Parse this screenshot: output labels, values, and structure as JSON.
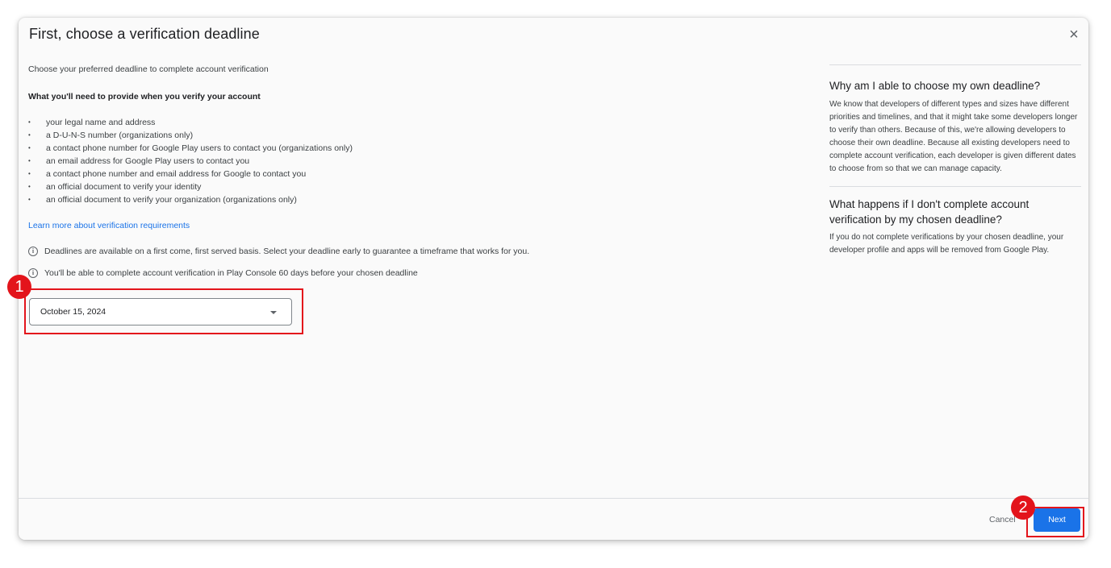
{
  "dialog": {
    "title": "First, choose a verification deadline",
    "close_icon": "×"
  },
  "left": {
    "subtitle": "Choose your preferred deadline to complete account verification",
    "requirements_title": "What you'll need to provide when you verify your account",
    "requirements": [
      "your legal name and address",
      "a D-U-N-S number (organizations only)",
      "a contact phone number for Google Play users to contact you (organizations only)",
      "an email address for Google Play users to contact you",
      "a contact phone number and email address for Google to contact you",
      "an official document to verify your identity",
      "an official document to verify your organization (organizations only)"
    ],
    "learn_more": "Learn more about verification requirements",
    "info1": "Deadlines are available on a first come, first served basis. Select your deadline early to guarantee a timeframe that works for you.",
    "info2": "You'll be able to complete account verification in Play Console 60 days before your chosen deadline",
    "info_icon": "info-icon"
  },
  "deadline_select": {
    "value": "October 15, 2024"
  },
  "right": {
    "q1": "Why am I able to choose my own deadline?",
    "a1": "We know that developers of different types and sizes have different priorities and timelines, and that it might take some developers longer to verify than others. Because of this, we're allowing developers to choose their own deadline. Because all existing developers need to complete account verification, each developer is given different dates to choose from so that we can manage capacity.",
    "q2": "What happens if I don't complete account verification by my chosen deadline?",
    "a2": "If you do not complete verifications by your chosen deadline, your developer profile and apps will be removed from Google Play."
  },
  "footer": {
    "cancel_label": "Cancel",
    "next_label": "Next"
  },
  "annotations": {
    "marker1": "1",
    "marker2": "2",
    "color": "#e3141b"
  },
  "colors": {
    "accent": "#1a73e8",
    "annotation": "#e3141b"
  }
}
